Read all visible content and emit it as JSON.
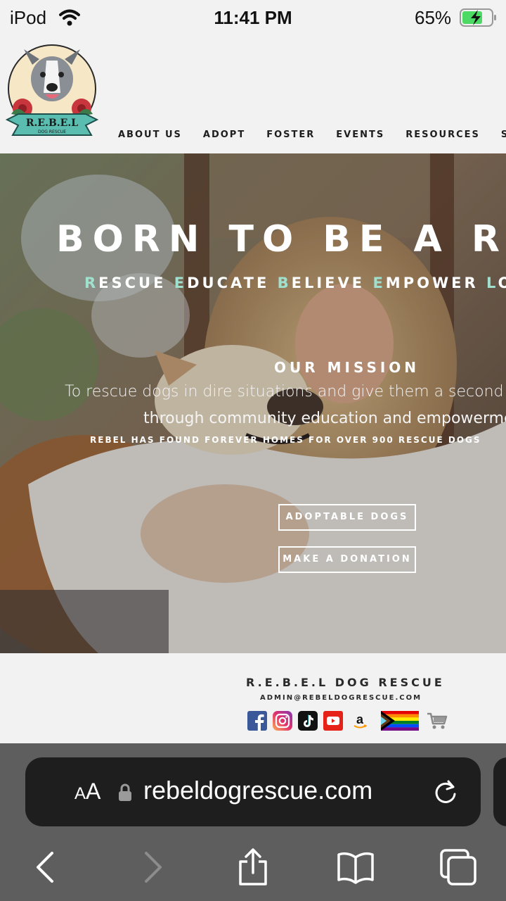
{
  "status_bar": {
    "carrier": "iPod",
    "time": "11:41 PM",
    "battery": "65%"
  },
  "site": {
    "logo_text": "R.E.B.E.L",
    "logo_subtext": "DOG RESCUE",
    "nav": [
      "ABOUT US",
      "ADOPT",
      "FOSTER",
      "EVENTS",
      "RESOURCES",
      "S"
    ]
  },
  "hero": {
    "title": "BORN TO BE A REBEL",
    "tagline": [
      {
        "initial": "R",
        "rest": "ESCUE"
      },
      {
        "initial": "E",
        "rest": "DUCATE"
      },
      {
        "initial": "B",
        "rest": "ELIEVE"
      },
      {
        "initial": "E",
        "rest": "MPOWER"
      },
      {
        "initial": "L",
        "rest": "OVE"
      }
    ],
    "mission_heading": "OUR MISSION",
    "mission_line1": "To rescue dogs in dire situations and give them a second chance",
    "mission_line2": "through community education and empowerment",
    "homes_stat": "REBEL HAS FOUND FOREVER HOMES FOR OVER 900 RESCUE DOGS",
    "buttons": [
      "ADOPTABLE DOGS",
      "MAKE A DONATION"
    ],
    "tagline_accent": "#9fe0cf"
  },
  "footer": {
    "name": "R.E.B.E.L DOG RESCUE",
    "email": "ADMIN@REBELDOGRESCUE.COM",
    "social_icons": [
      "facebook-icon",
      "instagram-icon",
      "tiktok-icon",
      "youtube-icon",
      "amazon-icon",
      "pride-flag-icon",
      "cart-icon"
    ]
  },
  "safari": {
    "text_size_small": "A",
    "text_size_big": "A",
    "url": "rebeldogrescue.com"
  }
}
